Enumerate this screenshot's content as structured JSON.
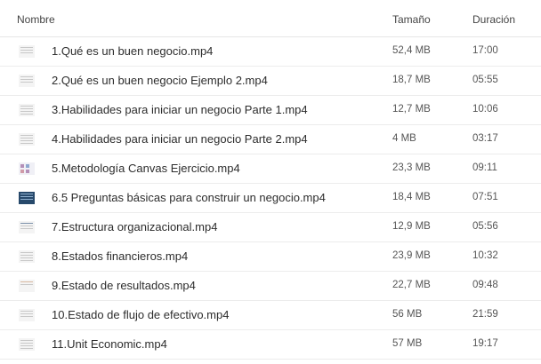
{
  "header": {
    "name": "Nombre",
    "size": "Tamaño",
    "duration": "Duración"
  },
  "files": [
    {
      "name": "1.Qué es un buen negocio.mp4",
      "size": "52,4 MB",
      "duration": "17:00",
      "thumb": "gray-doc-icon"
    },
    {
      "name": "2.Qué es un buen negocio Ejemplo 2.mp4",
      "size": "18,7 MB",
      "duration": "05:55",
      "thumb": "gray-doc-icon"
    },
    {
      "name": "3.Habilidades para iniciar un negocio Parte 1.mp4",
      "size": "12,7 MB",
      "duration": "10:06",
      "thumb": "text-lines-icon"
    },
    {
      "name": "4.Habilidades para iniciar un negocio Parte 2.mp4",
      "size": "4 MB",
      "duration": "03:17",
      "thumb": "text-lines-icon"
    },
    {
      "name": "5.Metodología Canvas Ejercicio.mp4",
      "size": "23,3 MB",
      "duration": "09:11",
      "thumb": "canvas-grid-icon"
    },
    {
      "name": "6.5 Preguntas básicas para construir un negocio.mp4",
      "size": "18,4 MB",
      "duration": "07:51",
      "thumb": "dark-slide-icon"
    },
    {
      "name": "7.Estructura organizacional.mp4",
      "size": "12,9 MB",
      "duration": "05:56",
      "thumb": "org-chart-icon"
    },
    {
      "name": "8.Estados financieros.mp4",
      "size": "23,9 MB",
      "duration": "10:32",
      "thumb": "table-doc-icon"
    },
    {
      "name": "9.Estado de resultados.mp4",
      "size": "22,7 MB",
      "duration": "09:48",
      "thumb": "small-doc-icon"
    },
    {
      "name": "10.Estado de flujo de efectivo.mp4",
      "size": "56 MB",
      "duration": "21:59",
      "thumb": "flow-doc-icon"
    },
    {
      "name": "11.Unit Economic.mp4",
      "size": "57 MB",
      "duration": "19:17",
      "thumb": "spreadsheet-icon"
    }
  ]
}
